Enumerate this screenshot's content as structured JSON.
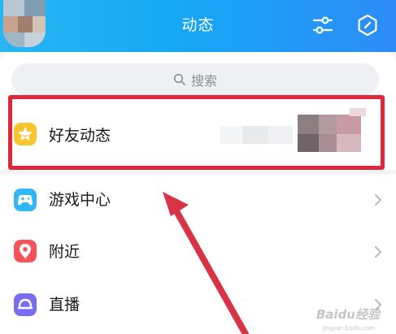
{
  "header": {
    "title": "动态",
    "icons": [
      "filter-sliders-icon",
      "hexagon-settings-icon"
    ]
  },
  "search": {
    "placeholder": "搜索"
  },
  "items": [
    {
      "label": "好友动态",
      "icon": "star-icon",
      "color": "#f7c52e"
    },
    {
      "label": "游戏中心",
      "icon": "gamepad-icon",
      "color": "#2fb8f5"
    },
    {
      "label": "附近",
      "icon": "location-pin-icon",
      "color": "#f4535b"
    },
    {
      "label": "直播",
      "icon": "live-icon",
      "color": "#7a6cf0"
    }
  ],
  "annotation": {
    "highlight_color": "#e0283b",
    "arrow_color": "#d93445"
  },
  "watermark": {
    "text": "Baidu经验",
    "sub": "jingyan.baidu.com"
  }
}
